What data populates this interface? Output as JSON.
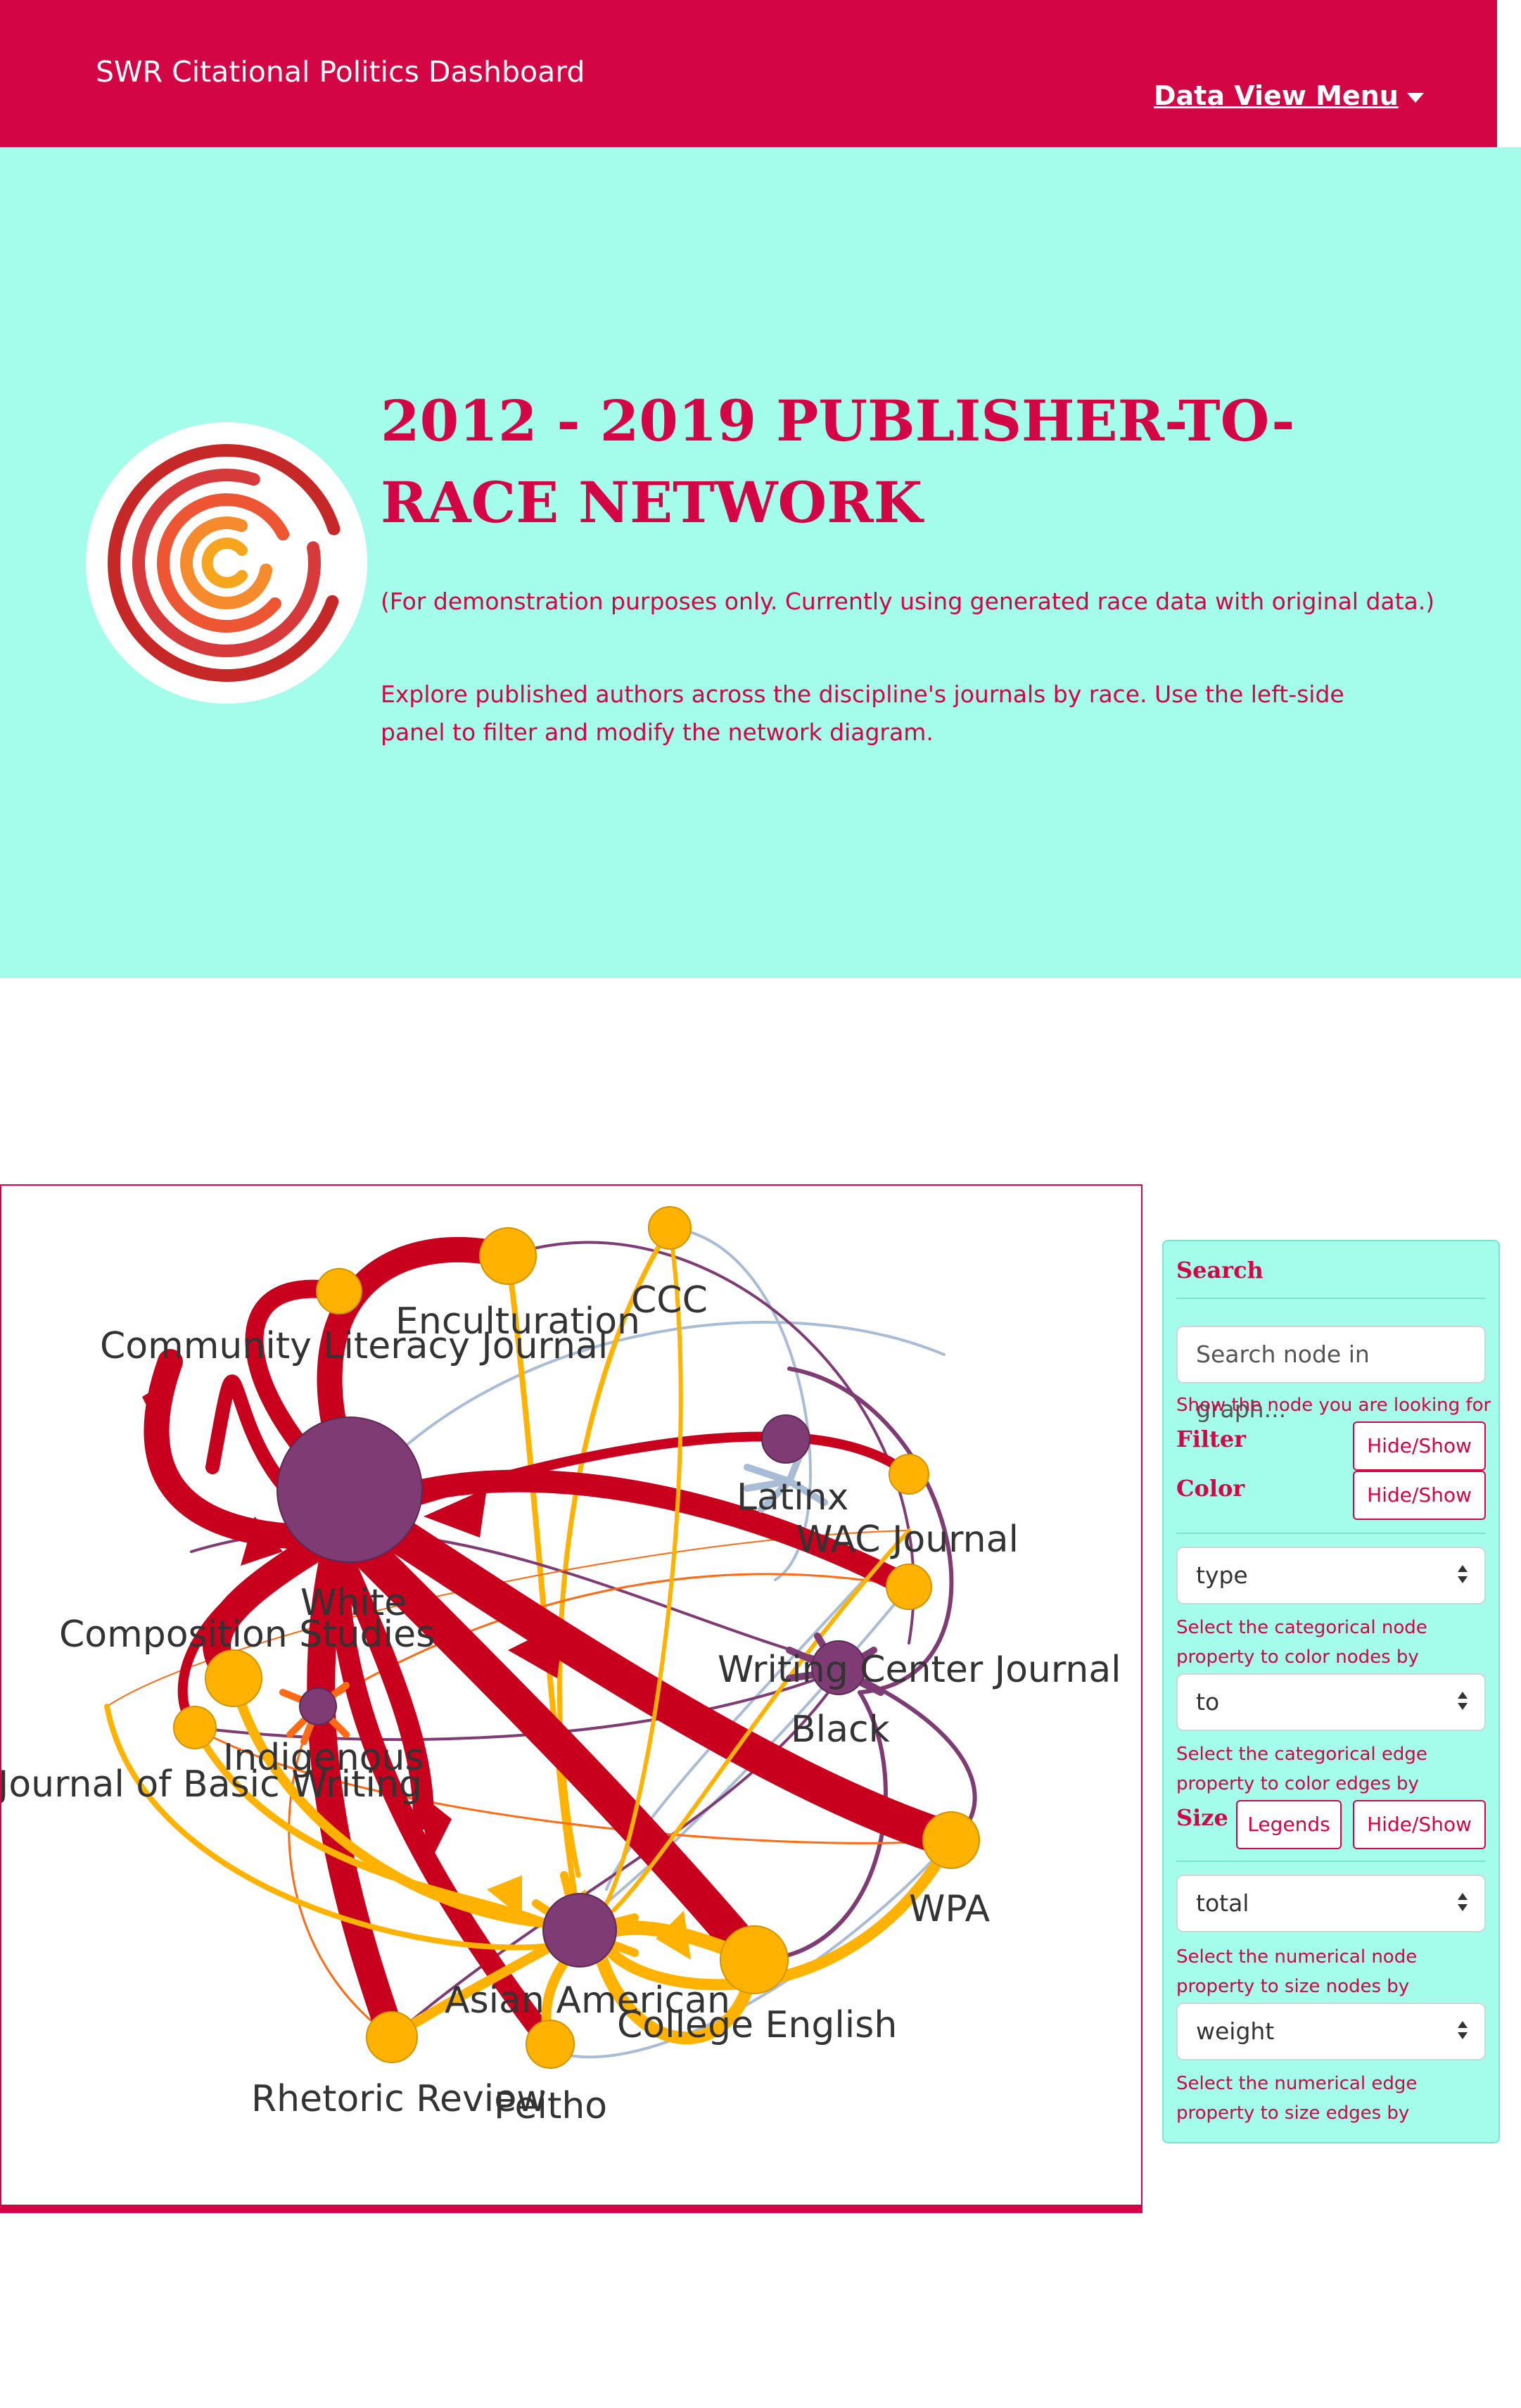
{
  "navbar": {
    "brand": "SWR Citational Politics Dashboard",
    "menu_label": "Data View Menu"
  },
  "hero": {
    "title": "2012 - 2019 PUBLISHER-TO-RACE NETWORK",
    "note": "(For demonstration purposes only. Currently using generated race data with original data.)",
    "description": "Explore published authors across the discipline's journals by race. Use the left-side panel to filter and modify the network diagram."
  },
  "graph": {
    "race_nodes": [
      "White",
      "Latinx",
      "Black",
      "Indigenous",
      "Asian American"
    ],
    "publisher_nodes": [
      "Enculturation",
      "CCC",
      "Community Literacy Journal",
      "WAC Journal",
      "Composition Studies",
      "Writing Center Journal",
      "Journal of Basic Writing",
      "WPA",
      "College English",
      "Rhetoric Review",
      "Peitho"
    ],
    "colors": {
      "race_node": "#7f3b73",
      "publisher_node": "#ffb300",
      "edge_white": "#c8001e",
      "edge_asian": "#ffb300",
      "edge_latinx": "#a9bcd6",
      "edge_black": "#7f3b73",
      "edge_indigenous": "#ff6a14"
    }
  },
  "panel": {
    "search_heading": "Search",
    "search_placeholder": "Search node in graph...",
    "search_hint": "Show the node you are looking for",
    "filter_label": "Filter",
    "filter_button": "Hide/Show",
    "color_label": "Color",
    "color_button": "Hide/Show",
    "node_color_select": "type",
    "node_color_hint": "Select the categorical node property to color nodes by",
    "edge_color_select": "to",
    "edge_color_hint": "Select the categorical edge property to color edges by",
    "size_label": "Size",
    "legends_button": "Legends",
    "size_button": "Hide/Show",
    "node_size_select": "total",
    "node_size_hint": "Select the numerical node property to size nodes by",
    "edge_size_select": "weight",
    "edge_size_hint": "Select the numerical edge property to size edges by"
  }
}
